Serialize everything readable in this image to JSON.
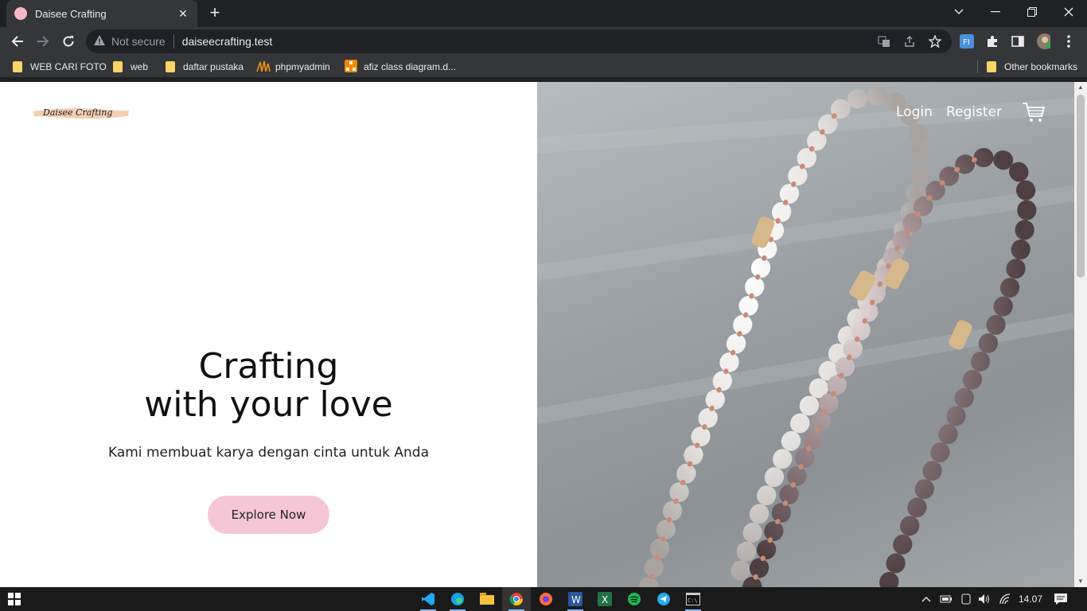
{
  "browser": {
    "tab_title": "Daisee Crafting",
    "tab_close": "✕",
    "new_tab": "+",
    "not_secure": "Not secure",
    "url": "daiseecrafting.test",
    "bookmarks": [
      "WEB CARI FOTO",
      "web",
      "daftar pustaka",
      "phpmyadmin",
      "afiz class diagram.d...",
      "Other bookmarks"
    ]
  },
  "site": {
    "logo_text": "Daisee Crafting",
    "nav": {
      "login": "Login",
      "register": "Register"
    },
    "headline_line1": "Crafting",
    "headline_line2": "with your love",
    "subtitle": "Kami membuat karya dengan cinta untuk Anda",
    "cta": "Explore Now",
    "colors": {
      "cta_bg": "#f5c6d6",
      "text": "#111111"
    }
  },
  "taskbar": {
    "clock": "14.07"
  }
}
